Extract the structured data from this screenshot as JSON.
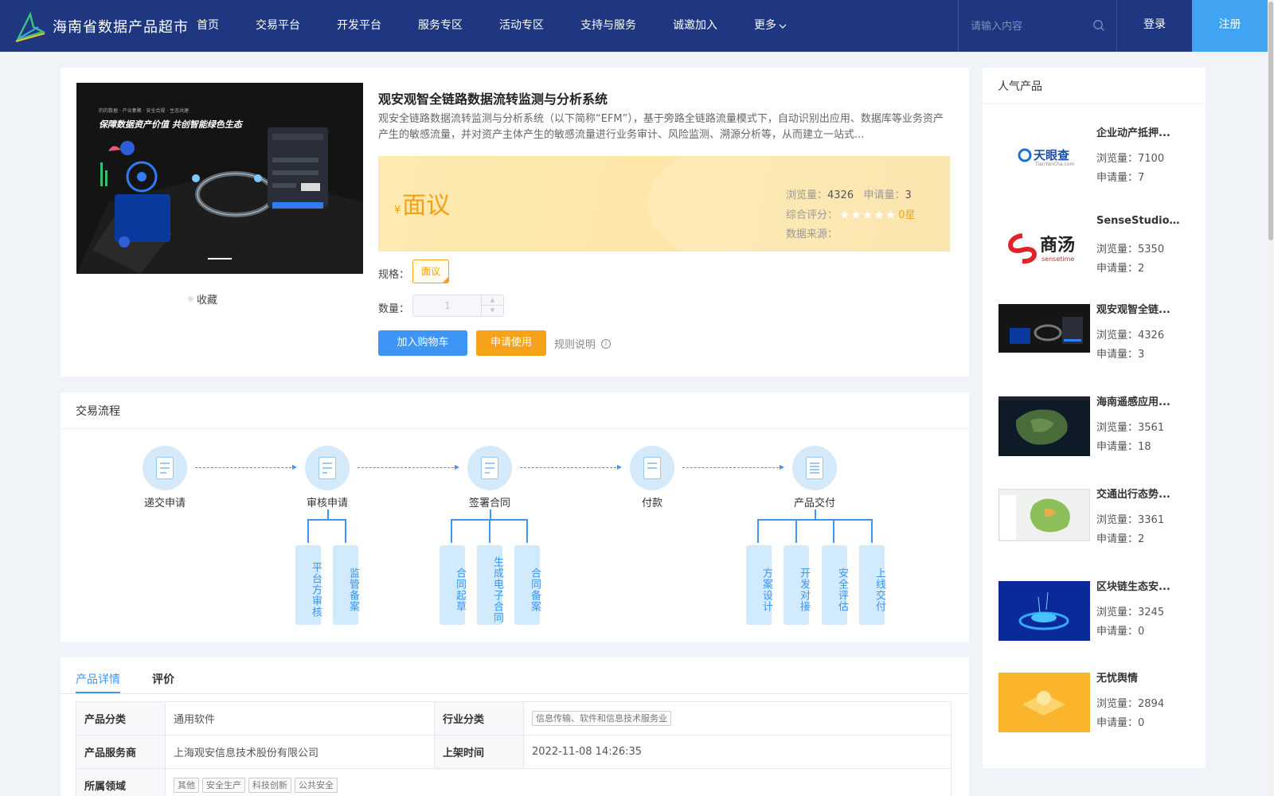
{
  "header": {
    "brand": "海南省数据产品超市",
    "nav": [
      "首页",
      "交易平台",
      "开发平台",
      "服务专区",
      "活动专区",
      "支持与服务",
      "诚邀加入",
      "更多"
    ],
    "search_placeholder": "请输入内容",
    "login": "登录",
    "register": "注册"
  },
  "product": {
    "title": "观安观智全链路数据流转监测与分析系统",
    "desc": "观安全链路数据流转监测与分析系统（以下简称“EFM”），基于旁路全链路流量模式下，自动识别出应用、数据库等业务资产产生的敏感流量，并对资产主体产生的敏感流量进行业务审计、风险监测、溯源分析等，从而建立一站式...",
    "banner_slogan": "保障数据资产价值  共创智能绿色生态",
    "banner_small": "的的数据 · 产业集聚 · 安全合规 · 生态共建",
    "favorite": "收藏",
    "price_symbol": "¥",
    "price": "面议",
    "views_label": "浏览量：",
    "views": "4326",
    "applies_label": "申请量：",
    "applies": "3",
    "rating_label": "综合评分：",
    "rating_value": "0星",
    "rating_stars": 0,
    "source_label": "数据来源：",
    "spec_label": "规格：",
    "spec": "面议",
    "qty_label": "数量：",
    "qty": "1",
    "add_cart": "加入购物车",
    "apply": "申请使用",
    "rules": "规则说明"
  },
  "flow": {
    "title": "交易流程",
    "steps": [
      "递交申请",
      "审核申请",
      "签署合同",
      "付款",
      "产品交付"
    ],
    "sub_review": [
      "平台方审核",
      "监管备案"
    ],
    "sub_contract": [
      "合同起草",
      "生成电子合同",
      "合同备案"
    ],
    "sub_delivery": [
      "方案设计",
      "开发对接",
      "安全评估",
      "上线交付"
    ]
  },
  "details": {
    "tabs": [
      "产品详情",
      "评价"
    ],
    "rows": [
      {
        "k1": "产品分类",
        "v1": "通用软件",
        "k2": "行业分类",
        "v2": "信息传输、软件和信息技术服务业"
      },
      {
        "k1": "产品服务商",
        "v1": "上海观安信息技术股份有限公司",
        "k2": "上架时间",
        "v2": "2022-11-08 14:26:35"
      }
    ],
    "domain_label": "所属领域",
    "domain_tags": [
      "其他",
      "安全生产",
      "科技创新",
      "公共安全"
    ]
  },
  "popular": {
    "title": "人气产品",
    "views_label": "浏览量：",
    "applies_label": "申请量：",
    "items": [
      {
        "name": "企业动产抵押...",
        "views": "7100",
        "applies": "7",
        "logo_text": "天眼查",
        "logo_sub": "TianYanCha.com"
      },
      {
        "name": "SenseStudio...",
        "views": "5350",
        "applies": "2",
        "logo_text": "商汤",
        "logo_sub": "sensetime"
      },
      {
        "name": "观安观智全链...",
        "views": "4326",
        "applies": "3"
      },
      {
        "name": "海南遥感应用...",
        "views": "3561",
        "applies": "18"
      },
      {
        "name": "交通出行态势...",
        "views": "3361",
        "applies": "2"
      },
      {
        "name": "区块链生态安...",
        "views": "3245",
        "applies": "0"
      },
      {
        "name": "无忧舆情",
        "views": "2894",
        "applies": "0"
      }
    ]
  },
  "colors": {
    "header": "#1e3780",
    "accent": "#3d96f5",
    "orange": "#f7a21b",
    "register": "#40a4f3"
  }
}
